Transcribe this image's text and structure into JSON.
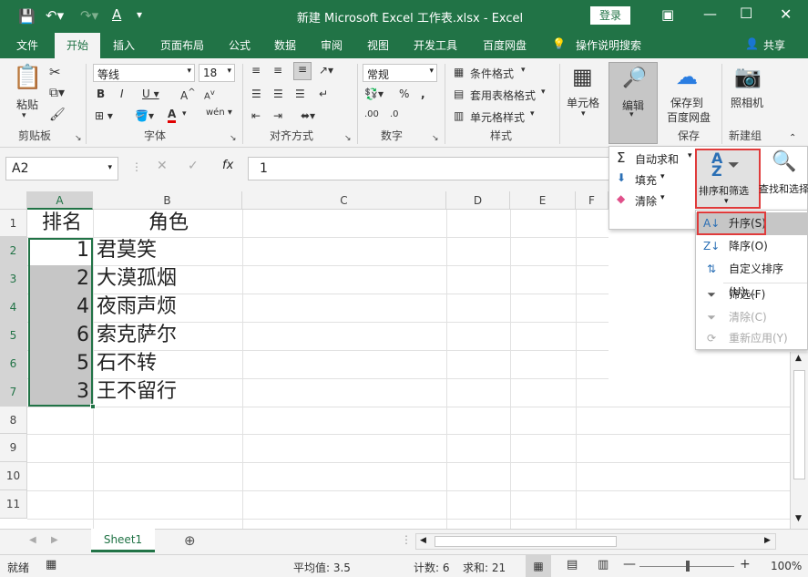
{
  "titlebar": {
    "title": "新建 Microsoft Excel 工作表.xlsx  -  Excel",
    "login": "登录"
  },
  "tabs": [
    "文件",
    "开始",
    "插入",
    "页面布局",
    "公式",
    "数据",
    "审阅",
    "视图",
    "开发工具",
    "百度网盘"
  ],
  "tell_me": "操作说明搜索",
  "share": "共享",
  "ribbon": {
    "paste": "粘贴",
    "clipboard": "剪贴板",
    "font_name": "等线",
    "font_size": "18",
    "font_group": "字体",
    "align_group": "对齐方式",
    "number_format": "常规",
    "number_group": "数字",
    "cond_format": "条件格式",
    "table_format": "套用表格格式",
    "cell_style": "单元格样式",
    "styles_group": "样式",
    "cells": "单元格",
    "edit": "编辑",
    "save_to": "保存到",
    "baidu_disk": "百度网盘",
    "save_group": "保存",
    "camera": "照相机",
    "new_group": "新建组"
  },
  "formula": {
    "namebox": "A2",
    "value": "1"
  },
  "columns": [
    "A",
    "B",
    "C",
    "D",
    "E",
    "F"
  ],
  "rows": [
    "1",
    "2",
    "3",
    "4",
    "5",
    "6",
    "7",
    "8",
    "9",
    "10",
    "11"
  ],
  "cells": {
    "header": [
      "排名",
      "角色"
    ],
    "data": [
      [
        "1",
        "君莫笑"
      ],
      [
        "2",
        "大漠孤烟"
      ],
      [
        "4",
        "夜雨声烦"
      ],
      [
        "6",
        "索克萨尔"
      ],
      [
        "5",
        "石不转"
      ],
      [
        "3",
        "王不留行"
      ]
    ]
  },
  "edit_panel": {
    "autosum": "自动求和",
    "fill": "填充",
    "clear": "清除",
    "sort_filter": "排序和筛选",
    "find_select": "查找和选择"
  },
  "sort_menu": {
    "asc": "升序(S)",
    "desc": "降序(O)",
    "custom": "自定义排序(U)...",
    "filter": "筛选(F)",
    "clear": "清除(C)",
    "reapply": "重新应用(Y)"
  },
  "sheet": {
    "tab": "Sheet1"
  },
  "status": {
    "ready": "就绪",
    "average": "平均值: 3.5",
    "count": "计数: 6",
    "sum": "求和: 21",
    "zoom": "100%"
  },
  "colors": {
    "accent": "#217346",
    "highlight": "#e03b3b",
    "selection": "#c6c6c6"
  }
}
